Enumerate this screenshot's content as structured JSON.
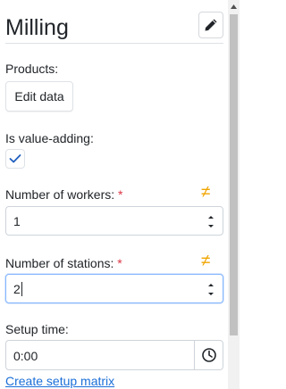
{
  "header": {
    "title": "Milling",
    "edit_icon": "pencil-icon"
  },
  "products": {
    "label": "Products:",
    "button_label": "Edit data"
  },
  "value_adding": {
    "label": "Is value-adding:",
    "checked": true
  },
  "workers": {
    "label": "Number of workers:",
    "required_mark": "*",
    "value": "1",
    "indicator": "≠"
  },
  "stations": {
    "label": "Number of stations:",
    "required_mark": "*",
    "value": "2",
    "indicator": "≠"
  },
  "setup_time": {
    "label": "Setup time:",
    "value": "0:00",
    "icon": "clock-icon",
    "link": "Create setup matrix"
  },
  "colors": {
    "accent": "#1a6fd8",
    "required": "#dc3545",
    "indicator": "#f0a500",
    "check": "#1f5fbf"
  }
}
